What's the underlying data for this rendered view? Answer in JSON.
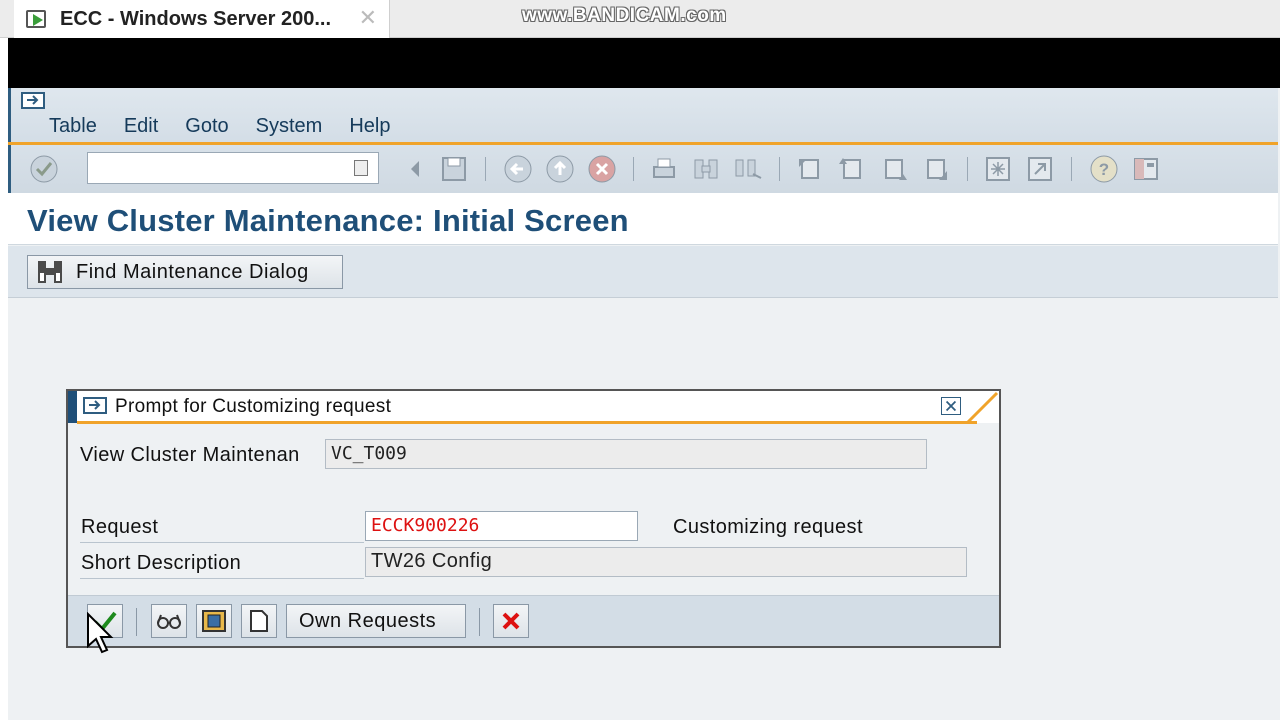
{
  "browser": {
    "tab_title": "ECC - Windows Server 200...",
    "watermark": "www.BANDICAM.com"
  },
  "menu": {
    "items": [
      "Table",
      "Edit",
      "Goto",
      "System",
      "Help"
    ]
  },
  "toolbar": {
    "command_field_value": "",
    "icons": [
      "enter-icon",
      "command-field-history-icon",
      "back-arrow-icon",
      "save-icon",
      "back-icon",
      "exit-icon",
      "cancel-icon",
      "print-icon",
      "find-icon",
      "find-next-icon",
      "first-page-icon",
      "previous-page-icon",
      "next-page-icon",
      "last-page-icon",
      "create-session-icon",
      "shortcut-icon",
      "help-icon",
      "layout-icon"
    ]
  },
  "page": {
    "title": "View Cluster Maintenance: Initial Screen",
    "find_button_label": "Find Maintenance Dialog"
  },
  "dialog": {
    "title": "Prompt for Customizing request",
    "view_cluster_label": "View Cluster Maintenan",
    "view_cluster_value": "VC_T009",
    "request_label": "Request",
    "request_value": "ECCK900226",
    "request_type": "Customizing request",
    "short_desc_label": "Short Description",
    "short_desc_value": "TW26 Config",
    "own_requests_label": "Own Requests"
  },
  "colors": {
    "sap_blue": "#1f4f78",
    "orange_accent": "#f0a32a",
    "request_red": "#dd1111"
  }
}
